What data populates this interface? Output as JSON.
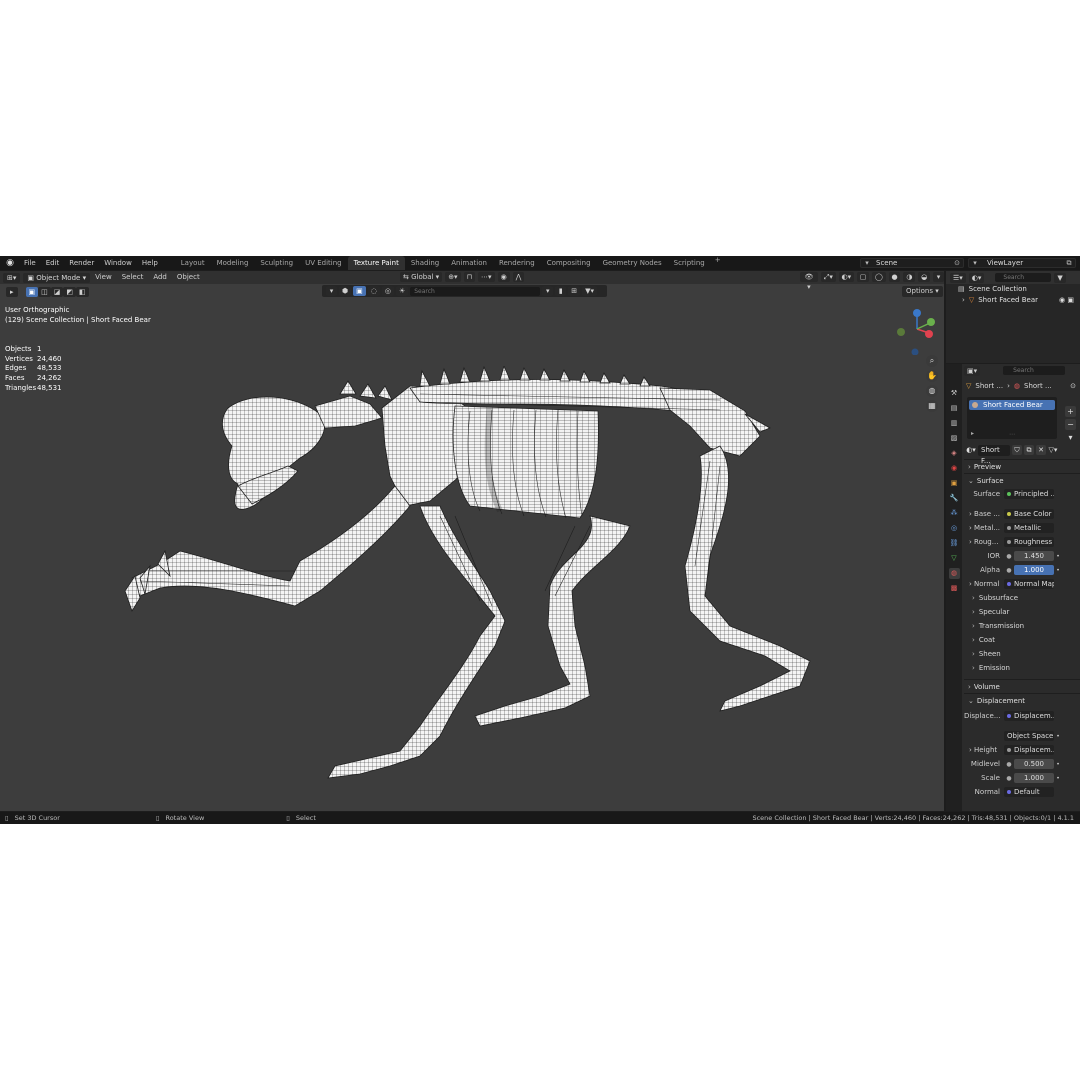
{
  "topbar": {
    "menus": [
      "File",
      "Edit",
      "Render",
      "Window",
      "Help"
    ],
    "workspaces": [
      "Layout",
      "Modeling",
      "Sculpting",
      "UV Editing",
      "Texture Paint",
      "Shading",
      "Animation",
      "Rendering",
      "Compositing",
      "Geometry Nodes",
      "Scripting"
    ],
    "active_workspace": "Texture Paint",
    "add_label": "+",
    "scene": "Scene",
    "view_layer": "ViewLayer"
  },
  "viewport": {
    "mode": "Object Mode",
    "menus": [
      "View",
      "Select",
      "Add",
      "Object"
    ],
    "transform_orientation": "Global",
    "search_placeholder": "Search",
    "options_label": "Options",
    "view_name": "User Orthographic",
    "collection_line": "(129) Scene Collection | Short Faced Bear",
    "stats": [
      {
        "label": "Objects",
        "value": "1"
      },
      {
        "label": "Vertices",
        "value": "24,460"
      },
      {
        "label": "Edges",
        "value": "48,533"
      },
      {
        "label": "Faces",
        "value": "24,262"
      },
      {
        "label": "Triangles",
        "value": "48,531"
      }
    ],
    "gizmo_colors": {
      "x": "#e0424f",
      "y": "#6ab04c",
      "z": "#3a78c9"
    }
  },
  "statusbar": {
    "left": [
      "Set 3D Cursor",
      "Rotate View",
      "Select"
    ],
    "right": "Scene Collection | Short Faced Bear | Verts:24,460 | Faces:24,262 | Tris:48,531 | Objects:0/1 | 4.1.1"
  },
  "outliner": {
    "search_placeholder": "Search",
    "root": "Scene Collection",
    "child": "Short Faced Bear"
  },
  "properties": {
    "search_placeholder": "Search",
    "breadcrumb_object": "Short ...",
    "breadcrumb_material": "Short ...",
    "slot": "Short Faced Bear",
    "material_name": "Short F...",
    "panels": {
      "preview": "Preview",
      "surface": "Surface",
      "volume": "Volume",
      "displacement": "Displacement"
    },
    "surface_rows": [
      {
        "label": "Surface",
        "value": "Principled ..."
      },
      {
        "label": "Base ...",
        "value": "Base Color"
      },
      {
        "label": "Metal...",
        "value": "Metallic"
      },
      {
        "label": "Roug...",
        "value": "Roughness"
      },
      {
        "label": "IOR",
        "value": "1.450"
      },
      {
        "label": "Alpha",
        "value": "1.000"
      },
      {
        "label": "Normal",
        "value": "Normal Map"
      }
    ],
    "sub_panels": [
      "Subsurface",
      "Specular",
      "Transmission",
      "Coat",
      "Sheen",
      "Emission"
    ],
    "displacement_rows": [
      {
        "label": "Displace...",
        "value": "Displacem..."
      },
      {
        "label": "",
        "value": "Object Space"
      },
      {
        "label": "Height",
        "value": "Displacem..."
      },
      {
        "label": "Midlevel",
        "value": "0.500"
      },
      {
        "label": "Scale",
        "value": "1.000"
      },
      {
        "label": "Normal",
        "value": "Default"
      }
    ]
  }
}
